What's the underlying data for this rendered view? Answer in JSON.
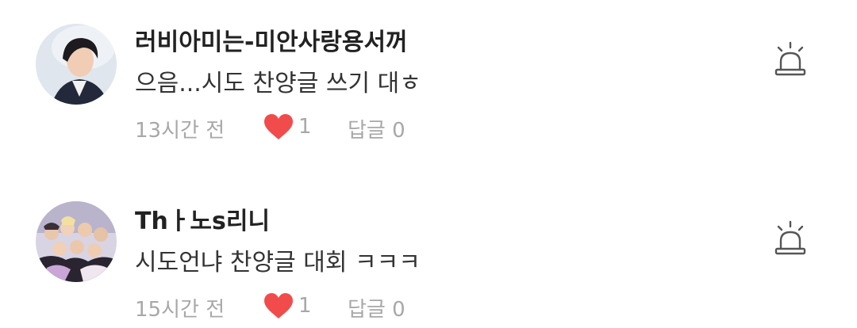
{
  "comments": [
    {
      "author": "러비아미는-미안사랑용서꺼",
      "text": "으음...시도 찬양글 쓰기 대ㅎ",
      "time": "13시간 전",
      "likes": "1",
      "reply_label": "답글",
      "reply_count": "0"
    },
    {
      "author": "Thㅏ노s리니",
      "text": "시도언냐 찬양글 대회 ㅋㅋㅋ",
      "time": "15시간 전",
      "likes": "1",
      "reply_label": "답글",
      "reply_count": "0"
    }
  ],
  "icons": {
    "like": "heart-icon",
    "report": "siren-icon"
  },
  "colors": {
    "heart": "#f24b4b",
    "meta_text": "#a8a8a8",
    "author_text": "#222222",
    "report_icon": "#555555"
  }
}
